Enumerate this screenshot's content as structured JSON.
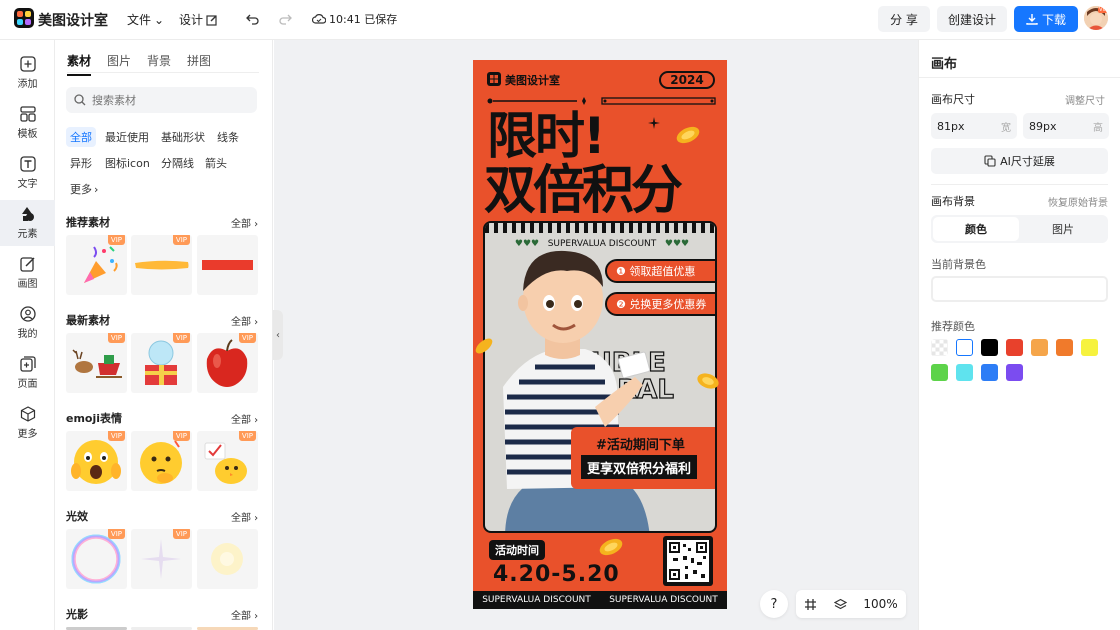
{
  "header": {
    "app_name": "美图设计室",
    "menu_file": "文件",
    "menu_design": "设计",
    "save_status": "10:41 已保存",
    "share_label": "分 享",
    "create_label": "创建设计",
    "download_label": "下载"
  },
  "rail": {
    "items": [
      {
        "label": "添加",
        "icon": "plus-square-icon"
      },
      {
        "label": "模板",
        "icon": "template-icon"
      },
      {
        "label": "文字",
        "icon": "text-icon"
      },
      {
        "label": "元素",
        "icon": "shapes-icon"
      },
      {
        "label": "画图",
        "icon": "draw-icon"
      },
      {
        "label": "我的",
        "icon": "user-icon"
      },
      {
        "label": "页面",
        "icon": "page-add-icon"
      },
      {
        "label": "更多",
        "icon": "cube-icon"
      }
    ],
    "active_index": 3
  },
  "panel": {
    "tabs": [
      "素材",
      "图片",
      "背景",
      "拼图"
    ],
    "search_placeholder": "搜索素材",
    "chips": [
      "全部",
      "最近使用",
      "基础形状",
      "线条",
      "异形",
      "图标icon",
      "分隔线",
      "箭头",
      "更多"
    ],
    "all_label": "全部",
    "vip": "VIP",
    "sections": [
      {
        "title": "推荐素材",
        "thumbs": [
          "party-popper",
          "yellow-brush-stroke",
          "red-bar"
        ]
      },
      {
        "title": "最新素材",
        "thumbs": [
          "reindeer-sleigh",
          "snow-globe-gift",
          "red-apple"
        ]
      },
      {
        "title": "emoji表情",
        "thumbs": [
          "shocked-emoji",
          "thinking-emoji",
          "chick-emoji"
        ]
      },
      {
        "title": "光效",
        "thumbs": [
          "bubble-ring",
          "star-sparkle",
          "soft-glow"
        ]
      },
      {
        "title": "光影",
        "thumbs": []
      }
    ]
  },
  "poster": {
    "brand": "美图设计室",
    "year": "2024",
    "headline_1": "限时!",
    "headline_2": "双倍积分",
    "discount_banner": "SUPERVALUA DISCOUNT",
    "benefit_1": "❶ 领取超值优惠",
    "benefit_2": "❷ 兑换更多优惠券",
    "ghost_text_1": "DOUBLE",
    "ghost_text_2": "INTEGRAL",
    "promo_1": "#活动期间下单",
    "promo_2": "更享双倍积分福利",
    "event_label": "活动时间",
    "dates": "4.20-5.20",
    "footer_1": "SUPERVALUA DISCOUNT",
    "footer_2": "SUPERVALUA DISCOUNT"
  },
  "bottom_tools": {
    "help": "?",
    "zoom": "100%"
  },
  "right_panel": {
    "title": "画布",
    "size_label": "画布尺寸",
    "adjust_size": "调整尺寸",
    "width_value": "81px",
    "width_unit": "宽",
    "height_value": "89px",
    "height_unit": "高",
    "ai_extend": "AI尺寸延展",
    "bg_label": "画布背景",
    "restore_bg": "恢复原始背景",
    "seg_color": "颜色",
    "seg_image": "图片",
    "current_bg": "当前背景色",
    "recommended": "推荐颜色",
    "swatches": [
      "transparent",
      "#ffffff",
      "#000000",
      "#e8412c",
      "#f5a54a",
      "#f07a2b",
      "#f6f23e",
      "#5dd34a",
      "#5fe3ee",
      "#2d7df6",
      "#7b4cf0"
    ]
  }
}
